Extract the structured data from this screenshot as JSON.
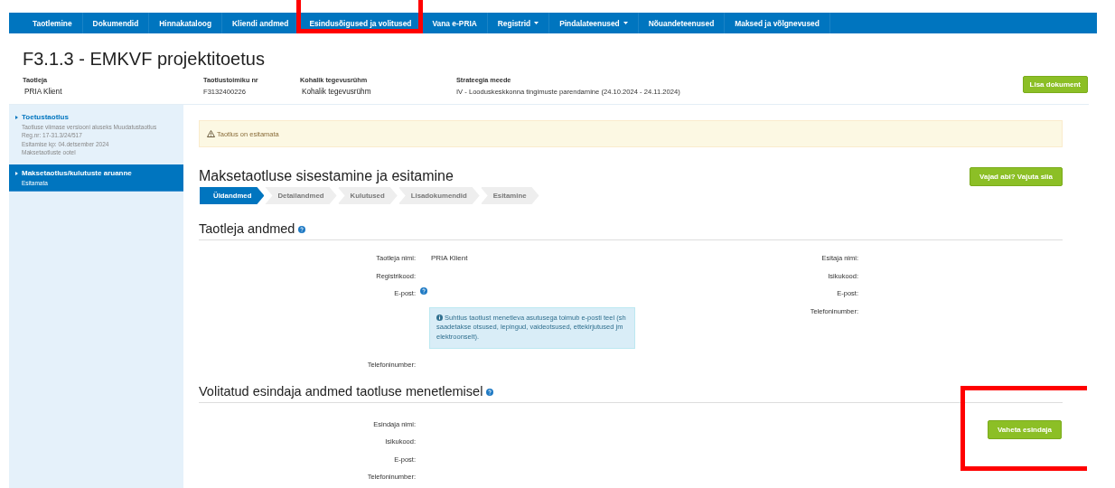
{
  "nav": {
    "items": [
      {
        "label": "Taotlemine",
        "dropdown": false,
        "highlighted": false
      },
      {
        "label": "Dokumendid",
        "dropdown": false,
        "highlighted": false
      },
      {
        "label": "Hinnakataloog",
        "dropdown": false,
        "highlighted": false
      },
      {
        "label": "Kliendi andmed",
        "dropdown": false,
        "highlighted": false
      },
      {
        "label": "Esindusõigused ja volitused",
        "dropdown": false,
        "highlighted": true
      },
      {
        "label": "Vana e-PRIA",
        "dropdown": false,
        "highlighted": false
      },
      {
        "label": "Registrid",
        "dropdown": true,
        "highlighted": false
      },
      {
        "label": "Pindalateenused",
        "dropdown": true,
        "highlighted": false
      },
      {
        "label": "Nõuandeteenused",
        "dropdown": false,
        "highlighted": false
      },
      {
        "label": "Maksed ja võlgnevused",
        "dropdown": false,
        "highlighted": false
      }
    ]
  },
  "page_title": "F3.1.3 - EMKVF projektitoetus",
  "summary": [
    {
      "label": "Taotleja",
      "value": "PRIA Klient"
    },
    {
      "label": "Taotlustoimiku nr",
      "value": "F3132400226"
    },
    {
      "label": "Kohalik tegevusrühm",
      "value": "Kohalik tegevusrühm"
    },
    {
      "label": "Strateegia meede",
      "value": "IV - Looduskeskkonna tingimuste parendamine (24.10.2024 - 24.11.2024)"
    }
  ],
  "add_document_button": "Lisa dokument",
  "sidebar": {
    "items": [
      {
        "title": "Toetustaotlus",
        "lines": [
          "Taotluse viimase versiooni aluseks Muudatustaotlus",
          "Reg.nr: 17-31.3/24/517",
          "Esitamise kp: 04.detsember 2024",
          "Maksetaotluste ootel"
        ],
        "selected": false
      },
      {
        "title": "Maksetaotlus/kulutuste aruanne",
        "lines": [
          "Esitamata"
        ],
        "selected": true
      }
    ]
  },
  "alert": "Taotlus on esitamata",
  "section_title": "Maksetaotluse sisestamine ja esitamine",
  "help_button": "Vajad abi? Vajuta siia",
  "steps": [
    {
      "label": "Üldandmed",
      "selected": true
    },
    {
      "label": "Detailandmed",
      "selected": false
    },
    {
      "label": "Kulutused",
      "selected": false
    },
    {
      "label": "Lisadokumendid",
      "selected": false
    },
    {
      "label": "Esitamine",
      "selected": false
    }
  ],
  "applicant": {
    "title": "Taotleja andmed",
    "left_fields": [
      {
        "kind": "field",
        "label": "Taotleja nimi:",
        "value": "PRIA Klient"
      },
      {
        "kind": "field",
        "label": "Registrikood:"
      },
      {
        "kind": "help_field",
        "label": "E-post:"
      },
      {
        "kind": "note",
        "text": "Suhtlus taotlust menetleva asutusega toimub e-posti teel (sh saadetakse otsused, lepingud, vaideotsused, ettekirjutused jm elektroonselt)."
      },
      {
        "kind": "field",
        "label": "Telefoninumber:"
      }
    ],
    "right_fields": [
      {
        "label": "Esitaja nimi:"
      },
      {
        "label": "Isikukood:"
      },
      {
        "label": "E-post:"
      },
      {
        "label": "Telefoninumber:"
      }
    ]
  },
  "representative": {
    "title": "Volitatud esindaja andmed taotluse menetlemisel",
    "fields": [
      {
        "label": "Esindaja nimi:"
      },
      {
        "label": "Isikukood:"
      },
      {
        "label": "E-post:"
      },
      {
        "label": "Telefoninumber:"
      }
    ],
    "button": "Vaheta esindaja",
    "highlighted": true
  }
}
